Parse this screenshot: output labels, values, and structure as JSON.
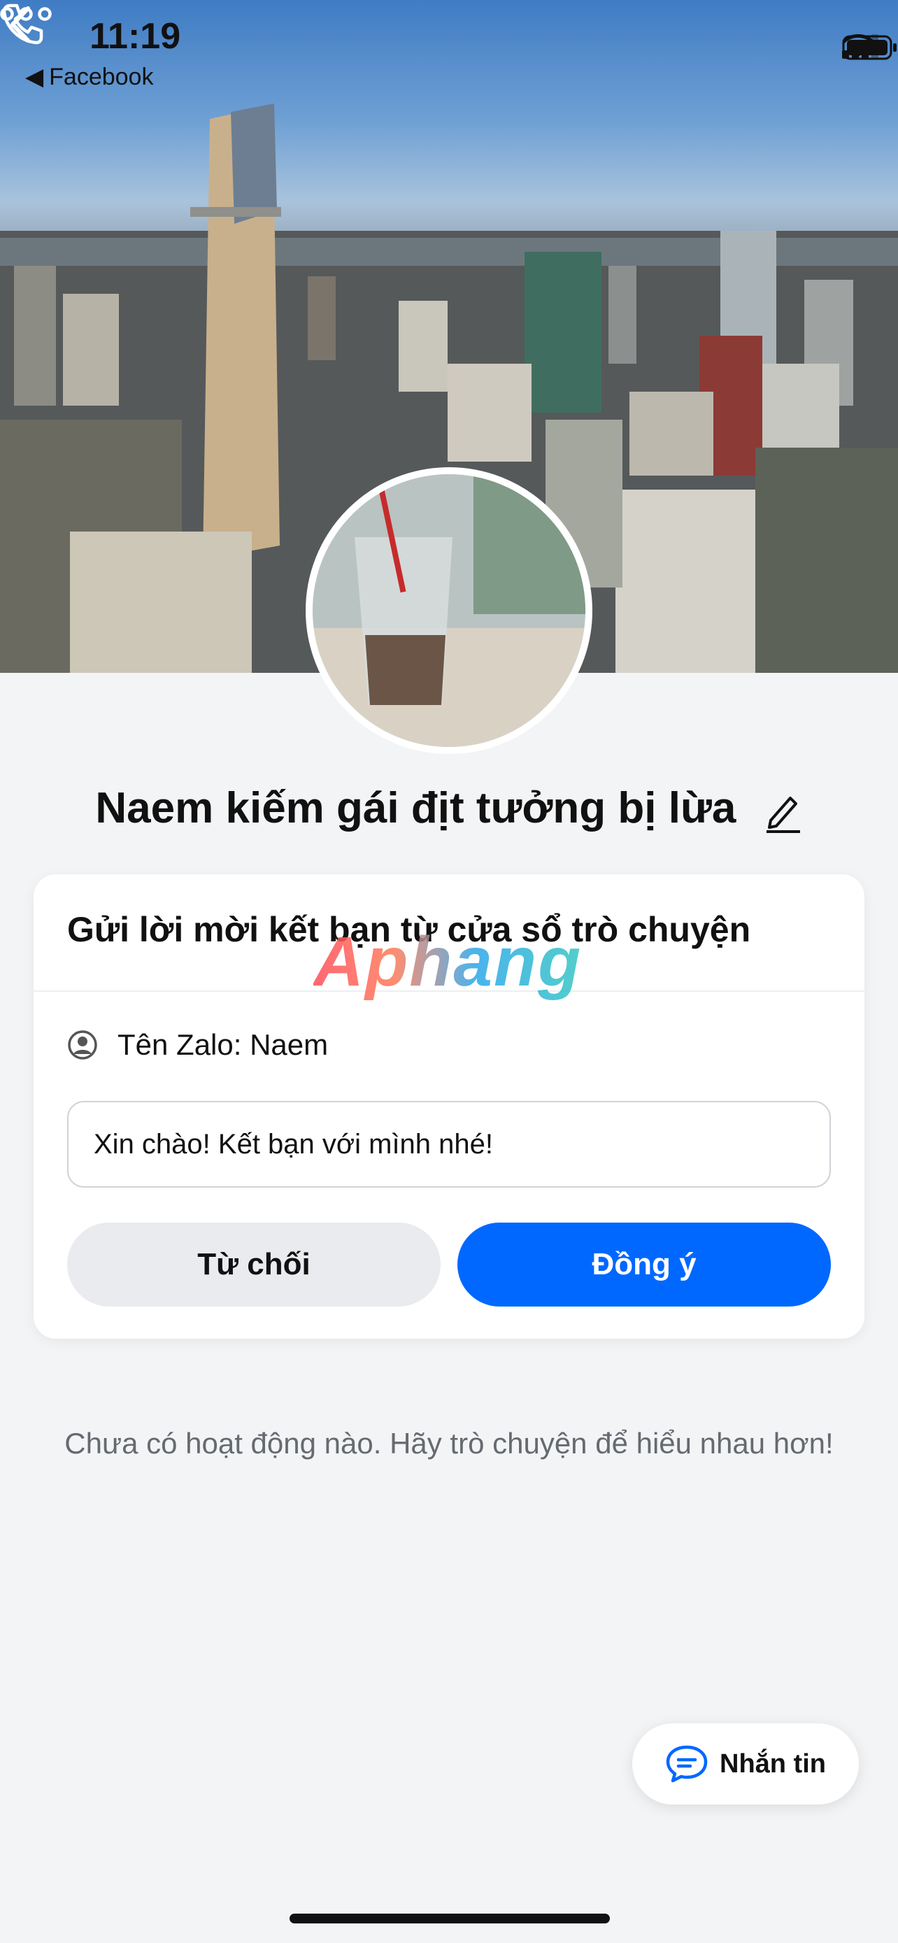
{
  "status_bar": {
    "time": "11:19",
    "back_app": "Facebook"
  },
  "profile": {
    "name": "Naem kiếm gái địt tưởng bị lừa"
  },
  "friend_request": {
    "title": "Gửi lời mời kết bạn từ cửa sổ trò chuyện",
    "zalo_name": "Tên Zalo: Naem",
    "message": "Xin chào! Kết bạn với mình nhé!",
    "decline_label": "Từ chối",
    "accept_label": "Đồng ý"
  },
  "watermark": "Aphang",
  "empty_state": "Chưa có hoạt động nào. Hãy trò chuyện để hiểu nhau hơn!",
  "fab": {
    "label": "Nhắn tin"
  },
  "colors": {
    "accent": "#0068ff",
    "background": "#f3f4f6",
    "card": "#ffffff"
  },
  "icons": [
    "back-icon",
    "phone-icon",
    "more-icon",
    "edit-pencil-icon",
    "user-circle-icon",
    "chat-bubble-icon",
    "signal-icon",
    "wifi-icon",
    "battery-icon"
  ]
}
